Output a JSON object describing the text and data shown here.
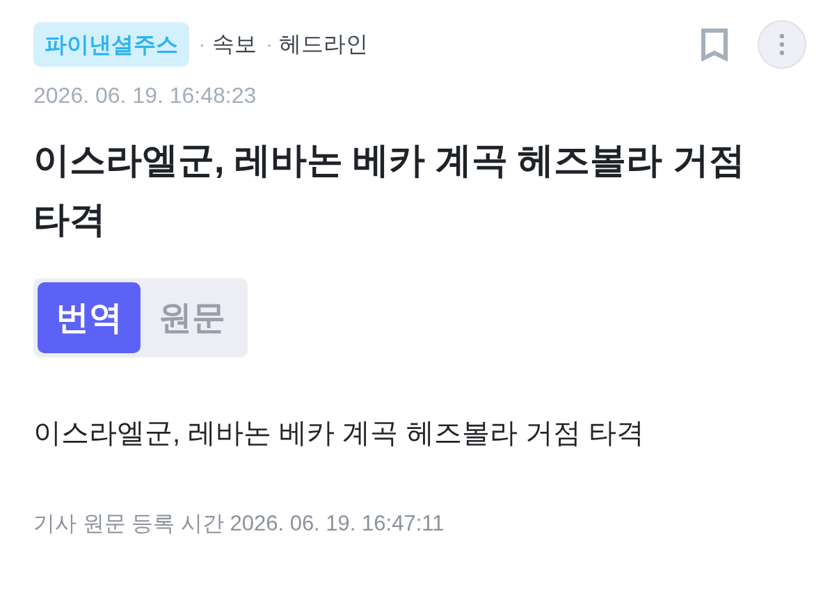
{
  "header": {
    "source_badge": "파이낸셜주스",
    "tags": [
      {
        "separator": "·",
        "label": "속보"
      },
      {
        "separator": "·",
        "label": "헤드라인"
      }
    ],
    "bookmarked": false
  },
  "published_time": "2026. 06. 19. 16:48:23",
  "title": "이스라엘군, 레바논 베카 계곡 헤즈볼라 거점 타격",
  "view_toggle": [
    {
      "label": "번역",
      "selected": true
    },
    {
      "label": "원문",
      "selected": false
    }
  ],
  "body": "이스라엘군, 레바논 베카 계곡 헤즈볼라 거점 타격",
  "original_registered": "기사 원문 등록 시간 2026. 06. 19. 16:47:11"
}
